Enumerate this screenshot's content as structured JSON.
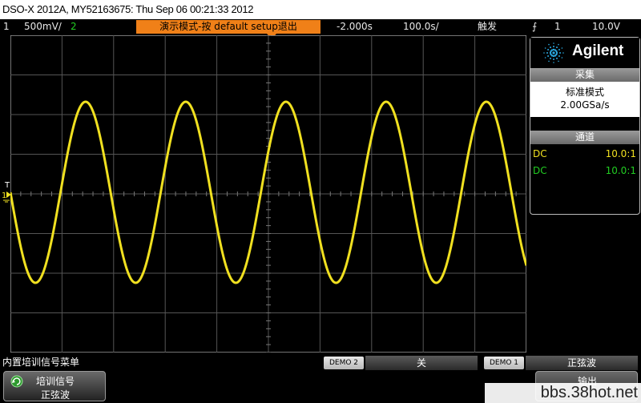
{
  "titlebar": {
    "text": "DSO-X 2012A, MY52163675: Thu Sep 06 00:21:33 2012"
  },
  "status": {
    "ch1_label": "1",
    "ch1_scale": "500mV/",
    "ch2_label": "2",
    "demo_banner": "演示模式-按 default setup退出",
    "time_offset": "-2.000s",
    "time_scale": "100.0s/",
    "trigger_mode": "触发",
    "trigger_source": "1",
    "trigger_level": "10.0V"
  },
  "brand": {
    "name": "Agilent"
  },
  "acquisition": {
    "header": "采集",
    "mode": "标准模式",
    "sample_rate": "2.00GSa/s"
  },
  "channels": {
    "header": "通道",
    "rows": [
      {
        "coupling": "DC",
        "probe": "10.0:1",
        "color": "#f0e020"
      },
      {
        "coupling": "DC",
        "probe": "10.0:1",
        "color": "#22cc22"
      }
    ]
  },
  "markers": {
    "trigger": "T",
    "ground": "1"
  },
  "bottom": {
    "menu_title": "内置培训信号菜单",
    "demo2_tag": "DEMO 2",
    "demo2_value": "关",
    "demo1_tag": "DEMO 1",
    "demo1_value": "正弦波",
    "softkey1_line1": "培训信号",
    "softkey1_line2": "正弦波",
    "softkey2_line1": "输出"
  },
  "watermark": "bbs.38hot.net",
  "waveform": {
    "shape": "sine",
    "cycles": 5.15,
    "color": "#f0e020"
  }
}
